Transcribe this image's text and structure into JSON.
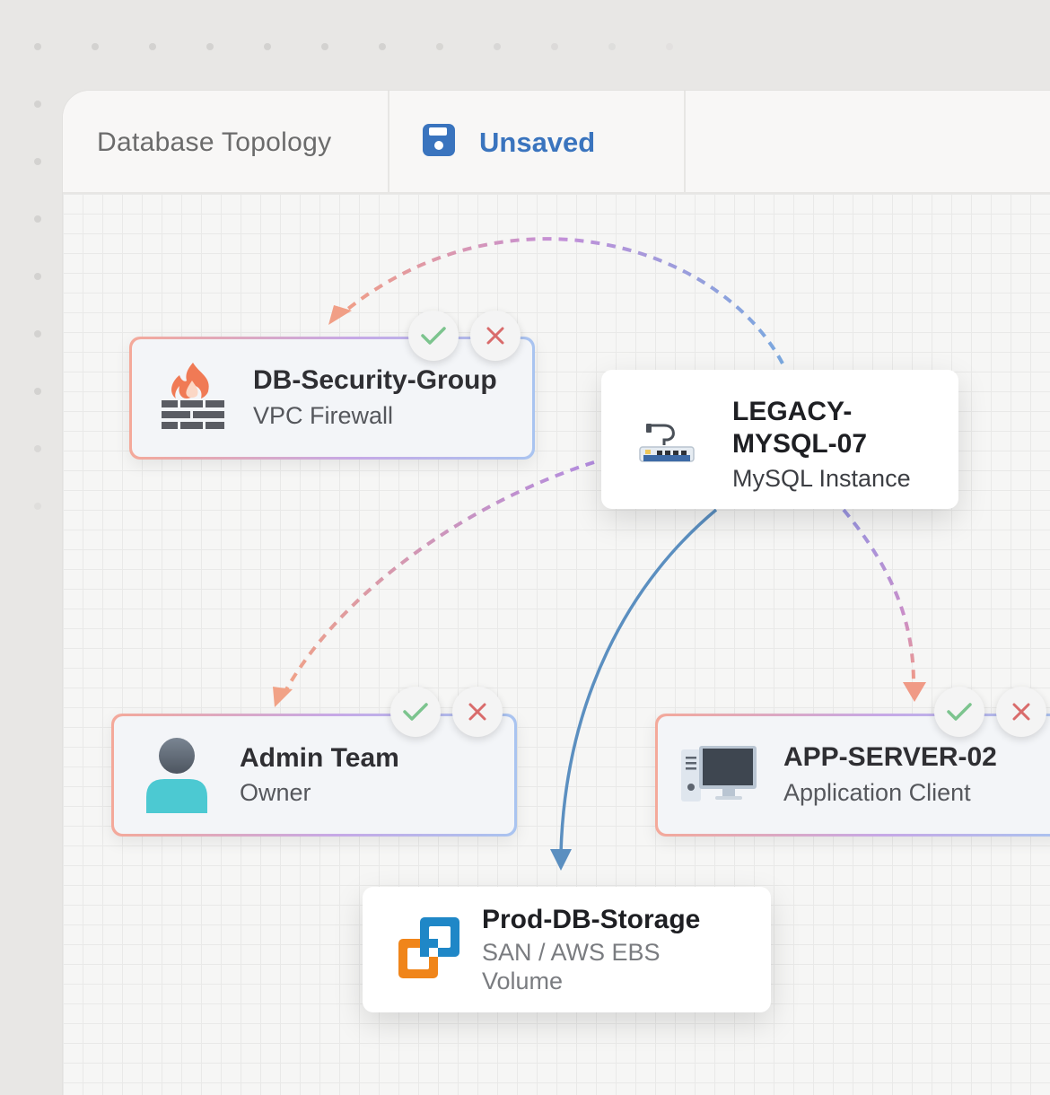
{
  "tabs": {
    "title": "Database Topology",
    "unsaved_label": "Unsaved",
    "save_icon": "floppy-disk-icon"
  },
  "colors": {
    "accent_blue": "#3a74be",
    "edge_salmon": "#f0a088",
    "edge_purple": "#b48ddf",
    "edge_blue": "#6d9fd4",
    "solid_edge": "#5b8fc0",
    "approve_green": "#7cc48e",
    "reject_red": "#d96b6b"
  },
  "nodes": {
    "security_group": {
      "title": "DB-Security-Group",
      "subtitle": "VPC Firewall",
      "icon": "firewall-icon"
    },
    "legacy_mysql": {
      "title_line1": "LEGACY-",
      "title_line2": "MYSQL-07",
      "subtitle": "MySQL Instance",
      "icon": "network-switch-icon"
    },
    "admin_team": {
      "title": "Admin Team",
      "subtitle": "Owner",
      "icon": "user-icon"
    },
    "app_server": {
      "title": "APP-SERVER-02",
      "subtitle": "Application Client",
      "icon": "desktop-computer-icon"
    },
    "prod_storage": {
      "title": "Prod-DB-Storage",
      "subtitle_line1": "SAN / AWS EBS",
      "subtitle_line2": "Volume",
      "icon": "storage-volume-icon"
    }
  }
}
